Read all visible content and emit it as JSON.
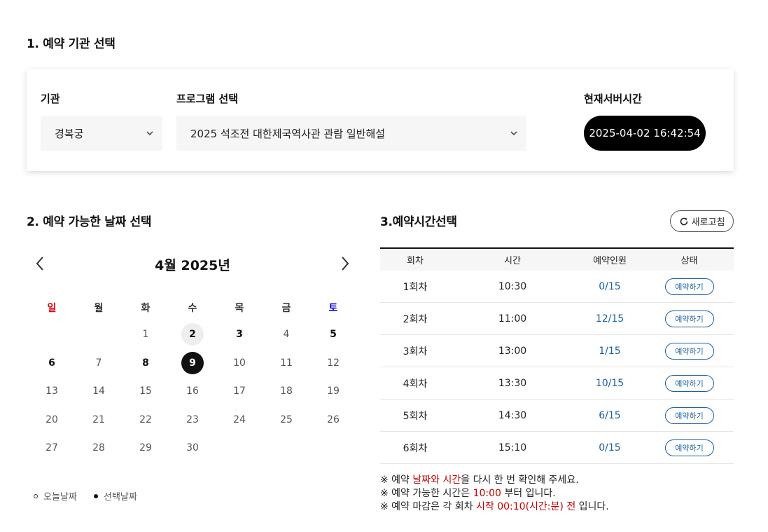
{
  "section1": {
    "title": "1. 예약 기관 선택",
    "institution_label": "기관",
    "institution_value": "경복궁",
    "program_label": "프로그램 선택",
    "program_value": "2025 석조전 대한제국역사관 관람 일반해설",
    "server_time_label": "현재서버시간",
    "server_time_value": "2025-04-02 16:42:54"
  },
  "section2": {
    "title": "2. 예약 가능한 날짜 선택",
    "month_title": "4월 2025년",
    "weekdays": [
      "일",
      "월",
      "화",
      "수",
      "목",
      "금",
      "토"
    ],
    "weekday_colors": {
      "sunday": "#e0000b",
      "saturday": "#0000d6"
    },
    "days": [
      {
        "d": "1",
        "col": 2,
        "row": 0,
        "style": ""
      },
      {
        "d": "2",
        "col": 3,
        "row": 0,
        "style": "today"
      },
      {
        "d": "3",
        "col": 4,
        "row": 0,
        "style": "bold"
      },
      {
        "d": "4",
        "col": 5,
        "row": 0,
        "style": ""
      },
      {
        "d": "5",
        "col": 6,
        "row": 0,
        "style": "bold"
      },
      {
        "d": "6",
        "col": 0,
        "row": 1,
        "style": "bold"
      },
      {
        "d": "7",
        "col": 1,
        "row": 1,
        "style": ""
      },
      {
        "d": "8",
        "col": 2,
        "row": 1,
        "style": "bold"
      },
      {
        "d": "9",
        "col": 3,
        "row": 1,
        "style": "selected"
      },
      {
        "d": "10",
        "col": 4,
        "row": 1,
        "style": ""
      },
      {
        "d": "11",
        "col": 5,
        "row": 1,
        "style": ""
      },
      {
        "d": "12",
        "col": 6,
        "row": 1,
        "style": ""
      },
      {
        "d": "13",
        "col": 0,
        "row": 2,
        "style": ""
      },
      {
        "d": "14",
        "col": 1,
        "row": 2,
        "style": ""
      },
      {
        "d": "15",
        "col": 2,
        "row": 2,
        "style": ""
      },
      {
        "d": "16",
        "col": 3,
        "row": 2,
        "style": ""
      },
      {
        "d": "17",
        "col": 4,
        "row": 2,
        "style": ""
      },
      {
        "d": "18",
        "col": 5,
        "row": 2,
        "style": ""
      },
      {
        "d": "19",
        "col": 6,
        "row": 2,
        "style": ""
      },
      {
        "d": "20",
        "col": 0,
        "row": 3,
        "style": ""
      },
      {
        "d": "21",
        "col": 1,
        "row": 3,
        "style": ""
      },
      {
        "d": "22",
        "col": 2,
        "row": 3,
        "style": ""
      },
      {
        "d": "23",
        "col": 3,
        "row": 3,
        "style": ""
      },
      {
        "d": "24",
        "col": 4,
        "row": 3,
        "style": ""
      },
      {
        "d": "25",
        "col": 5,
        "row": 3,
        "style": ""
      },
      {
        "d": "26",
        "col": 6,
        "row": 3,
        "style": ""
      },
      {
        "d": "27",
        "col": 0,
        "row": 4,
        "style": ""
      },
      {
        "d": "28",
        "col": 1,
        "row": 4,
        "style": ""
      },
      {
        "d": "29",
        "col": 2,
        "row": 4,
        "style": ""
      },
      {
        "d": "30",
        "col": 3,
        "row": 4,
        "style": ""
      }
    ],
    "legend_today": "오늘날짜",
    "legend_selected": "선택날짜"
  },
  "section3": {
    "title": "3.예약시간선택",
    "refresh_label": "새로고침",
    "columns": [
      "회차",
      "시간",
      "예약인원",
      "상태"
    ],
    "rows": [
      {
        "round": "1회차",
        "time": "10:30",
        "count": "0/15",
        "action": "예약하기"
      },
      {
        "round": "2회차",
        "time": "11:00",
        "count": "12/15",
        "action": "예약하기"
      },
      {
        "round": "3회차",
        "time": "13:00",
        "count": "1/15",
        "action": "예약하기"
      },
      {
        "round": "4회차",
        "time": "13:30",
        "count": "10/15",
        "action": "예약하기"
      },
      {
        "round": "5회차",
        "time": "14:30",
        "count": "6/15",
        "action": "예약하기"
      },
      {
        "round": "6회차",
        "time": "15:10",
        "count": "0/15",
        "action": "예약하기"
      }
    ],
    "notes": {
      "n1_a": "※ 예약 ",
      "n1_b": "날짜와 시간",
      "n1_c": "을 다시 한 번 확인해 주세요.",
      "n2_a": "※ 예약 가능한 시간은 ",
      "n2_b": "10:00",
      "n2_c": " 부터 입니다.",
      "n3_a": "※ 예약 마감은 각 회차 ",
      "n3_b": "시작  00:10(시간:분) 전",
      "n3_c": " 입니다."
    }
  }
}
